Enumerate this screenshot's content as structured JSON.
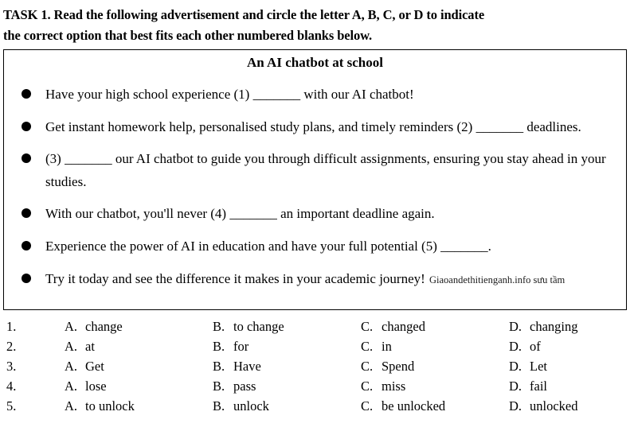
{
  "task": {
    "heading_line1": "TASK 1. Read the following advertisement and circle the letter A, B, C, or D to indicate",
    "heading_line2": "the correct option that best fits each other numbered blanks below."
  },
  "advertisement": {
    "title": "An AI chatbot at school",
    "watermark": "Giaoandethitienganh.info sưu tầm",
    "bullets": [
      "Have your high school experience (1) _______ with our AI chatbot!",
      "Get instant homework help, personalised study plans, and timely reminders (2) _______ deadlines.",
      "(3) _______ our AI chatbot to guide you through difficult assignments, ensuring you stay ahead in your studies.",
      "With our chatbot, you'll never (4) _______ an important deadline again.",
      "Experience the power of AI in education and have your full potential (5) _______.",
      "Try it today and see the difference it makes in your academic journey!"
    ]
  },
  "questions": [
    {
      "number": "1.",
      "choices": [
        {
          "letter": "A.",
          "text": "change"
        },
        {
          "letter": "B.",
          "text": "to change"
        },
        {
          "letter": "C.",
          "text": "changed"
        },
        {
          "letter": "D.",
          "text": "changing"
        }
      ]
    },
    {
      "number": "2.",
      "choices": [
        {
          "letter": "A.",
          "text": "at"
        },
        {
          "letter": "B.",
          "text": "for"
        },
        {
          "letter": "C.",
          "text": "in"
        },
        {
          "letter": "D.",
          "text": "of"
        }
      ]
    },
    {
      "number": "3.",
      "choices": [
        {
          "letter": "A.",
          "text": "Get"
        },
        {
          "letter": "B.",
          "text": "Have"
        },
        {
          "letter": "C.",
          "text": "Spend"
        },
        {
          "letter": "D.",
          "text": "Let"
        }
      ]
    },
    {
      "number": "4.",
      "choices": [
        {
          "letter": "A.",
          "text": "lose"
        },
        {
          "letter": "B.",
          "text": "pass"
        },
        {
          "letter": "C.",
          "text": "miss"
        },
        {
          "letter": "D.",
          "text": "fail"
        }
      ]
    },
    {
      "number": "5.",
      "choices": [
        {
          "letter": "A.",
          "text": "to unlock"
        },
        {
          "letter": "B.",
          "text": "unlock"
        },
        {
          "letter": "C.",
          "text": "be unlocked"
        },
        {
          "letter": "D.",
          "text": "unlocked"
        }
      ]
    }
  ],
  "colors": {
    "text": "#000000",
    "border": "#000000",
    "background": "#ffffff"
  }
}
